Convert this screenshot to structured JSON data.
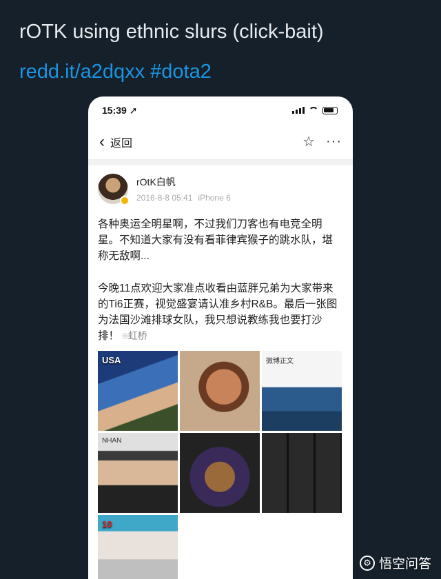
{
  "tweet": {
    "text": "rOTK using ethnic slurs (click-bait)",
    "link": "redd.it/a2dqxx",
    "hashtag": "#dota2"
  },
  "phone": {
    "status": {
      "time": "15:39"
    },
    "nav": {
      "back_label": "返回"
    },
    "post": {
      "author": "rOtK白帆",
      "date": "2016-8-8 05:41",
      "device": "iPhone 6",
      "para1": "各种奥运全明星啊，不过我们刀客也有电竞全明星。不知道大家有没有看菲律宾猴子的跳水队，堪称无敌啊...",
      "para2": "今晚11点欢迎大家准点收看由蓝胖兄弟为大家带来的Ti6正赛，视觉盛宴请认准乡村R&B。最后一张图为法国沙滩排球女队，我只想说教练我也要打沙排！",
      "location": "虹桥",
      "images": {
        "t1": "USA",
        "t3": "微博正文",
        "t4": "NHAN",
        "t7": "10"
      }
    }
  },
  "watermark": {
    "label": "悟空问答"
  }
}
